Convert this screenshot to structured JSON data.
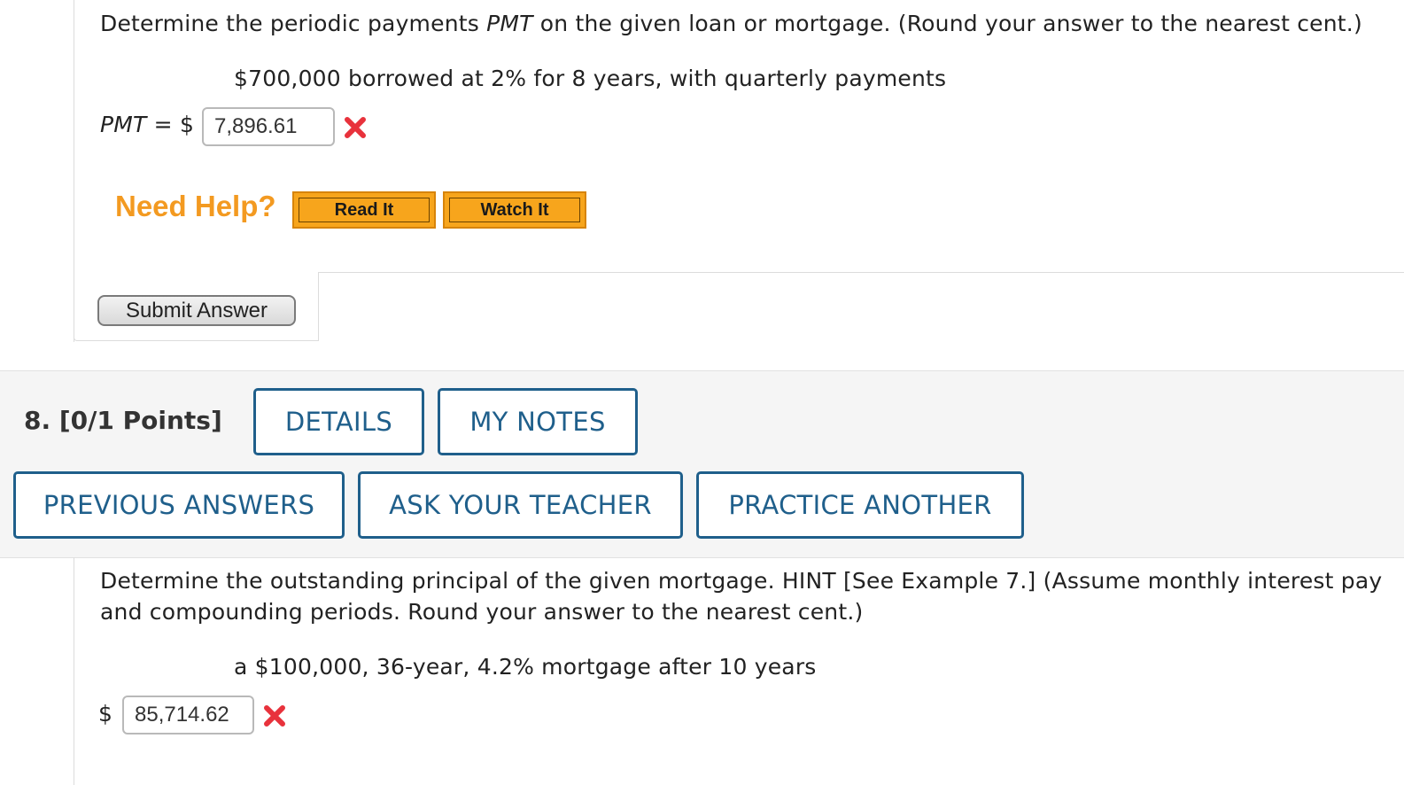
{
  "q7": {
    "instruction_pre": "Determine the periodic payments ",
    "instruction_var": "PMT",
    "instruction_post": " on the given loan or mortgage. (Round your answer to the nearest cent.)",
    "problem": "$700,000 borrowed at 2% for 8 years, with quarterly payments",
    "pmt_label": "PMT",
    "equals_dollar": " = $",
    "answer_value": "7,896.61",
    "need_help": "Need Help?",
    "read_it": "Read It",
    "watch_it": "Watch It",
    "submit": "Submit Answer"
  },
  "q8": {
    "number": "8.",
    "points": "[0/1 Points]",
    "buttons": {
      "details": "DETAILS",
      "my_notes": "MY NOTES",
      "previous_answers": "PREVIOUS ANSWERS",
      "ask_teacher": "ASK YOUR TEACHER",
      "practice_another": "PRACTICE ANOTHER"
    },
    "instruction_line1": "Determine the outstanding principal of the given mortgage. HINT [See Example 7.] (Assume monthly interest pay",
    "instruction_line2": "and compounding periods. Round your answer to the nearest cent.)",
    "problem": "a $100,000, 36-year, 4.2% mortgage after 10 years",
    "dollar": "$",
    "answer_value": "85,714.62"
  },
  "colors": {
    "accent": "#1f5f8b",
    "help_orange": "#f39a21",
    "incorrect_red": "#e8323c"
  }
}
